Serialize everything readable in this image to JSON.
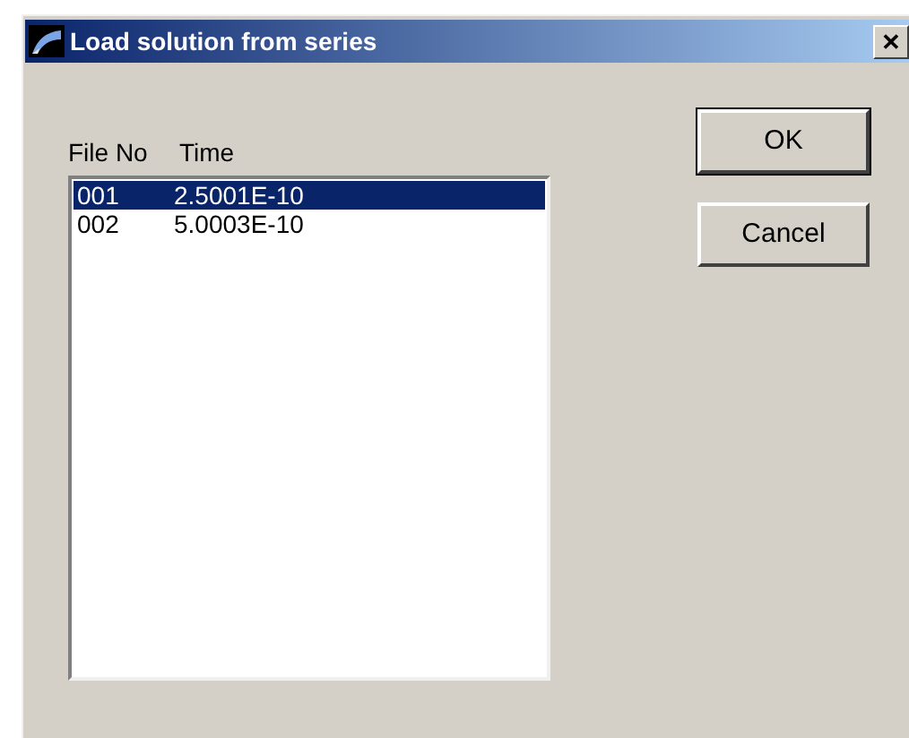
{
  "window": {
    "title": "Load solution from series",
    "close": "✕"
  },
  "list": {
    "columns": [
      "File No",
      "Time"
    ],
    "rows": [
      {
        "file_no": "001",
        "time": "2.5001E-10",
        "selected": true
      },
      {
        "file_no": "002",
        "time": "5.0003E-10",
        "selected": false
      }
    ]
  },
  "buttons": [
    "OK",
    "Cancel"
  ]
}
